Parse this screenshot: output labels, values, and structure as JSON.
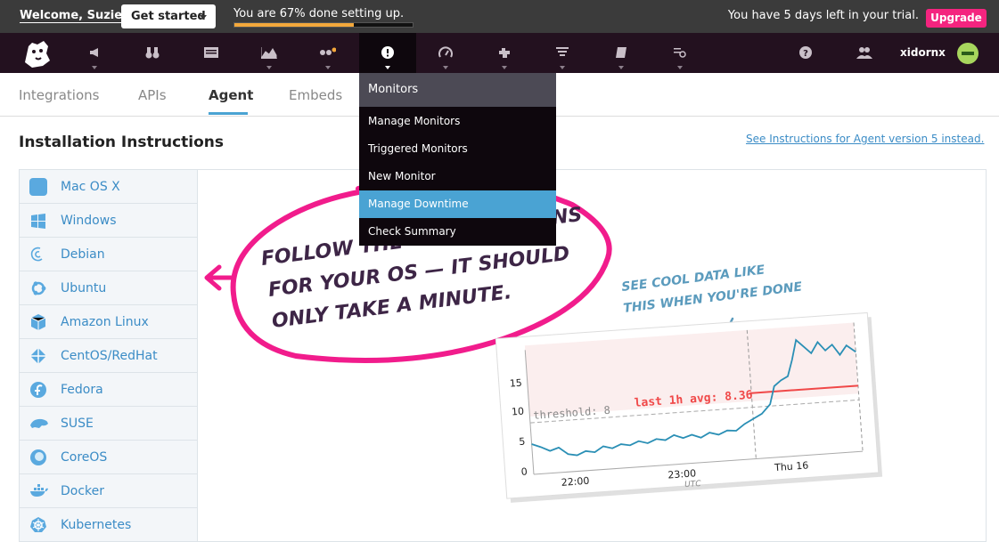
{
  "topbar": {
    "welcome": "Welcome, Suzie!",
    "get_started": "Get started",
    "progress_text": "You are 67% done setting up.",
    "progress_fraction": 0.67,
    "trial_text": "You have 5 days left in your trial.",
    "upgrade": "Upgrade"
  },
  "nav": {
    "icons": [
      "datadog-logo",
      "announcement-icon",
      "binoculars-icon",
      "dashboard-icon",
      "chart-icon",
      "infrastructure-icon",
      "monitors-icon",
      "apm-icon",
      "integrations-icon",
      "logs-icon",
      "notebook-icon",
      "synthetics-icon",
      "help-icon",
      "team-icon"
    ],
    "user": "xidornx"
  },
  "tabs": [
    "Integrations",
    "APIs",
    "Agent",
    "Embeds"
  ],
  "heading": "Installation Instructions",
  "v5_link": "See Instructions for Agent version 5 instead.",
  "os_list": [
    "Mac OS X",
    "Windows",
    "Debian",
    "Ubuntu",
    "Amazon Linux",
    "CentOS/RedHat",
    "Fedora",
    "SUSE",
    "CoreOS",
    "Docker",
    "Kubernetes"
  ],
  "monitors_menu": {
    "title": "Monitors",
    "items": [
      "Manage Monitors",
      "Triggered Monitors",
      "New Monitor",
      "Manage Downtime",
      "Check Summary"
    ]
  },
  "illustration": {
    "note_left_line1": "FOLLOW THE",
    "note_left_line1_end": "NS",
    "note_left_line2": "FOR YOUR OS — IT SHOULD",
    "note_left_line3": "ONLY TAKE A MINUTE.",
    "note_right_line1": "SEE COOL DATA LIKE",
    "note_right_line2": "THIS WHEN YOU'RE DONE",
    "chart": {
      "y_ticks": [
        "15",
        "10",
        "5",
        "0"
      ],
      "x_ticks": [
        "22:00",
        "23:00",
        "Thu 16"
      ],
      "utc": "UTC",
      "threshold_label": "threshold: 8",
      "avg_label": "last 1h avg: 8.36"
    }
  },
  "colors": {
    "accent": "#f4247f",
    "link": "#3b8cc6",
    "nav_bg": "#23111f",
    "menu_selected": "#4aa3d3",
    "progress": "#f3a83b"
  }
}
